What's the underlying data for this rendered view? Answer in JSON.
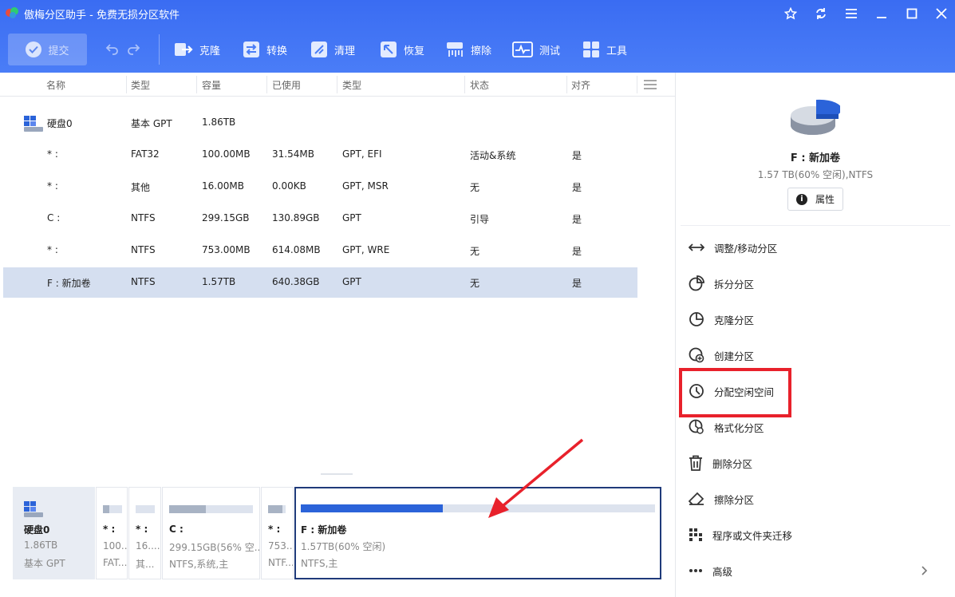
{
  "app": {
    "title": "傲梅分区助手 - 免费无损分区软件"
  },
  "toolbar": {
    "submit": "提交",
    "items": [
      {
        "label": "克隆",
        "icon": "clone-icon"
      },
      {
        "label": "转换",
        "icon": "convert-icon"
      },
      {
        "label": "清理",
        "icon": "clean-icon"
      },
      {
        "label": "恢复",
        "icon": "recover-icon"
      },
      {
        "label": "擦除",
        "icon": "wipe-icon"
      },
      {
        "label": "测试",
        "icon": "test-icon"
      },
      {
        "label": "工具",
        "icon": "tools-icon"
      }
    ]
  },
  "table": {
    "columns": [
      "名称",
      "类型",
      "容量",
      "已使用",
      "类型",
      "状态",
      "对齐"
    ],
    "disk": {
      "name": "硬盘0",
      "type": "基本 GPT",
      "capacity": "1.86TB"
    },
    "rows": [
      {
        "name": "* :",
        "type": "FAT32",
        "capacity": "100.00MB",
        "used": "31.54MB",
        "ptype": "GPT, EFI",
        "status": "活动&系统",
        "align": "是"
      },
      {
        "name": "* :",
        "type": "其他",
        "capacity": "16.00MB",
        "used": "0.00KB",
        "ptype": "GPT, MSR",
        "status": "无",
        "align": "是"
      },
      {
        "name": "C :",
        "type": "NTFS",
        "capacity": "299.15GB",
        "used": "130.89GB",
        "ptype": "GPT",
        "status": "引导",
        "align": "是"
      },
      {
        "name": "* :",
        "type": "NTFS",
        "capacity": "753.00MB",
        "used": "614.08MB",
        "ptype": "GPT, WRE",
        "status": "无",
        "align": "是"
      },
      {
        "name": "F : 新加卷",
        "type": "NTFS",
        "capacity": "1.57TB",
        "used": "640.38GB",
        "ptype": "GPT",
        "status": "无",
        "align": "是"
      }
    ]
  },
  "diskmap": {
    "disk": {
      "name": "硬盘0",
      "size": "1.86TB",
      "type": "基本 GPT"
    },
    "parts": [
      {
        "name": "* :",
        "size": "100...",
        "fs": "FAT...",
        "fill": 0.32
      },
      {
        "name": "* :",
        "size": "16....",
        "fs": "其...",
        "fill": 0.0
      },
      {
        "name": "C :",
        "size": "299.15GB(56% 空...",
        "fs": "NTFS,系统,主",
        "fill": 0.44
      },
      {
        "name": "* :",
        "size": "753...",
        "fs": "NTF...",
        "fill": 0.82
      },
      {
        "name": "F : 新加卷",
        "size": "1.57TB(60% 空闲)",
        "fs": "NTFS,主",
        "fill": 0.4
      }
    ]
  },
  "side": {
    "name": "F : 新加卷",
    "info": "1.57 TB(60% 空闲),NTFS",
    "properties": "属性",
    "actions": [
      {
        "label": "调整/移动分区",
        "icon": "resize-move-icon"
      },
      {
        "label": "拆分分区",
        "icon": "split-partition-icon"
      },
      {
        "label": "克隆分区",
        "icon": "clone-partition-icon"
      },
      {
        "label": "创建分区",
        "icon": "create-partition-icon"
      },
      {
        "label": "分配空闲空间",
        "icon": "allocate-space-icon"
      },
      {
        "label": "格式化分区",
        "icon": "format-partition-icon"
      },
      {
        "label": "删除分区",
        "icon": "delete-icon"
      },
      {
        "label": "擦除分区",
        "icon": "eraser-icon"
      },
      {
        "label": "程序或文件夹迁移",
        "icon": "migrate-icon"
      },
      {
        "label": "高级",
        "icon": "more-icon"
      }
    ]
  },
  "colors": {
    "accent": "#3a6cf2",
    "selected_row": "#d5dff0",
    "highlight_box": "#e8212b",
    "bar_fill": "#2b63d9",
    "bar_fill_gray": "#a8b3c4"
  }
}
